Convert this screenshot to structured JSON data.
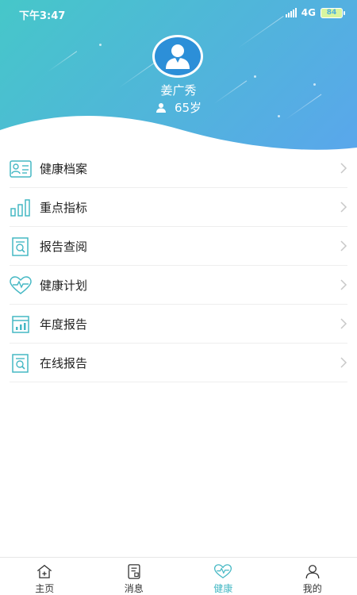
{
  "status_bar": {
    "time": "下午3:47",
    "network": "4G",
    "battery": "84"
  },
  "profile": {
    "name": "姜广秀",
    "age": "65岁"
  },
  "menu": [
    {
      "label": "健康档案",
      "icon": "health-record-icon"
    },
    {
      "label": "重点指标",
      "icon": "bar-chart-icon"
    },
    {
      "label": "报告查阅",
      "icon": "report-search-icon"
    },
    {
      "label": "健康计划",
      "icon": "heart-pulse-icon"
    },
    {
      "label": "年度报告",
      "icon": "annual-report-icon"
    },
    {
      "label": "在线报告",
      "icon": "online-report-icon"
    }
  ],
  "tabs": [
    {
      "label": "主页",
      "icon": "home-icon",
      "active": false
    },
    {
      "label": "消息",
      "icon": "message-icon",
      "active": false
    },
    {
      "label": "健康",
      "icon": "health-heart-icon",
      "active": true
    },
    {
      "label": "我的",
      "icon": "person-icon",
      "active": false
    }
  ],
  "colors": {
    "header_start": "#46c7c9",
    "header_end": "#5aa6ec",
    "icon_accent": "#45b8c4",
    "avatar_bg": "#2c8fd8"
  }
}
